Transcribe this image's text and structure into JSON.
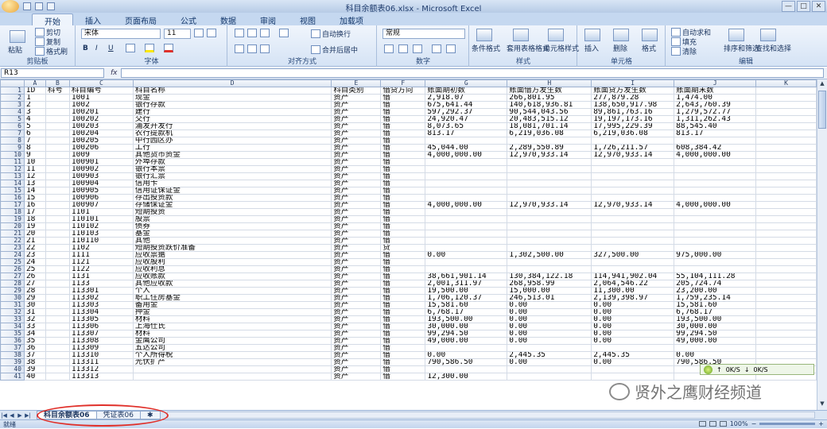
{
  "window": {
    "title": "科目余额表06.xlsx - Microsoft Excel",
    "controls": [
      "—",
      "□",
      "✕"
    ]
  },
  "ribbon": {
    "tabs": [
      "开始",
      "插入",
      "页面布局",
      "公式",
      "数据",
      "审阅",
      "视图",
      "加载项"
    ],
    "active_tab": "开始",
    "clipboard": {
      "label": "剪贴板",
      "paste": "粘贴",
      "cut": "剪切",
      "copy": "复制",
      "format_painter": "格式刷"
    },
    "font": {
      "label": "字体",
      "name": "宋体",
      "size": "11",
      "bold": "B",
      "italic": "I",
      "underline": "U"
    },
    "alignment": {
      "label": "对齐方式",
      "wrap": "自动换行",
      "merge": "合并后居中"
    },
    "number": {
      "label": "数字",
      "format": "常规"
    },
    "styles": {
      "label": "样式",
      "conditional": "条件格式",
      "table": "套用表格格式",
      "cell": "单元格样式"
    },
    "cells": {
      "label": "单元格",
      "insert": "插入",
      "delete": "删除",
      "format": "格式"
    },
    "editing": {
      "label": "编辑",
      "autosum": "自动求和",
      "fill": "填充",
      "clear": "清除",
      "sort": "排序和筛选",
      "find": "查找和选择"
    }
  },
  "formula_bar": {
    "name_box": "R13",
    "fx": "fx",
    "value": ""
  },
  "sheet": {
    "columns": [
      "A",
      "B",
      "C",
      "D",
      "E",
      "F",
      "G",
      "H",
      "I",
      "J",
      "K"
    ],
    "rows": [
      {
        "n": "1",
        "c": [
          "ID",
          "科号",
          "科目编号",
          "科目名称",
          "科目类别",
          "借贷方向",
          "账面期初数",
          "账面借方发生数",
          "账面贷方发生数",
          "账面期末数",
          ""
        ]
      },
      {
        "n": "2",
        "c": [
          "1",
          "",
          "1001",
          "现金",
          "资产",
          "借",
          "2,918.07",
          "266,801.95",
          "277,879.28",
          "1,474.00",
          ""
        ]
      },
      {
        "n": "3",
        "c": [
          "2",
          "",
          "1002",
          "银行存款",
          "资产",
          "借",
          "675,641.44",
          "140,618,936.81",
          "138,650,917.98",
          "2,643,760.39",
          ""
        ]
      },
      {
        "n": "4",
        "c": [
          "3",
          "",
          "100201",
          "建行",
          "资产",
          "借",
          "597,292.37",
          "90,544,043.56",
          "89,861,763.16",
          "1,279,572.77",
          ""
        ]
      },
      {
        "n": "5",
        "c": [
          "4",
          "",
          "100202",
          "交行",
          "资产",
          "借",
          "24,920.47",
          "20,483,515.12",
          "19,197,173.16",
          "1,311,262.43",
          ""
        ]
      },
      {
        "n": "6",
        "c": [
          "5",
          "",
          "100203",
          "浦发开发行",
          "资产",
          "借",
          "8,073.65",
          "18,081,701.14",
          "17,995,229.39",
          "88,545.40",
          ""
        ]
      },
      {
        "n": "7",
        "c": [
          "6",
          "",
          "100204",
          "农行提款机",
          "资产",
          "借",
          "813.17",
          "6,219,036.08",
          "6,219,036.08",
          "813.17",
          ""
        ]
      },
      {
        "n": "8",
        "c": [
          "7",
          "",
          "100205",
          "中行园区办",
          "资产",
          "借",
          "",
          "",
          "",
          "",
          ""
        ]
      },
      {
        "n": "9",
        "c": [
          "8",
          "",
          "100206",
          "工行",
          "资产",
          "借",
          "45,044.00",
          "2,289,550.89",
          "1,726,211.57",
          "608,384.42",
          ""
        ]
      },
      {
        "n": "10",
        "c": [
          "9",
          "",
          "1009",
          "其他货币资金",
          "资产",
          "借",
          "4,000,000.00",
          "12,970,933.14",
          "12,970,933.14",
          "4,000,000.00",
          ""
        ]
      },
      {
        "n": "11",
        "c": [
          "10",
          "",
          "100901",
          "外埠存款",
          "资产",
          "借",
          "",
          "",
          "",
          "",
          ""
        ]
      },
      {
        "n": "12",
        "c": [
          "11",
          "",
          "100902",
          "银行本票",
          "资产",
          "借",
          "",
          "",
          "",
          "",
          ""
        ]
      },
      {
        "n": "13",
        "c": [
          "12",
          "",
          "100903",
          "银行汇票",
          "资产",
          "借",
          "",
          "",
          "",
          "",
          ""
        ]
      },
      {
        "n": "14",
        "c": [
          "13",
          "",
          "100904",
          "信用卡",
          "资产",
          "借",
          "",
          "",
          "",
          "",
          ""
        ]
      },
      {
        "n": "15",
        "c": [
          "14",
          "",
          "100905",
          "信用证保证金",
          "资产",
          "借",
          "",
          "",
          "",
          "",
          ""
        ]
      },
      {
        "n": "16",
        "c": [
          "15",
          "",
          "100906",
          "存出投资款",
          "资产",
          "借",
          "",
          "",
          "",
          "",
          ""
        ]
      },
      {
        "n": "17",
        "c": [
          "16",
          "",
          "100907",
          "存储保证金",
          "资产",
          "借",
          "4,000,000.00",
          "12,970,933.14",
          "12,970,933.14",
          "4,000,000.00",
          ""
        ]
      },
      {
        "n": "18",
        "c": [
          "17",
          "",
          "1101",
          "短期投资",
          "资产",
          "借",
          "",
          "",
          "",
          "",
          ""
        ]
      },
      {
        "n": "19",
        "c": [
          "18",
          "",
          "110101",
          "股票",
          "资产",
          "借",
          "",
          "",
          "",
          "",
          ""
        ]
      },
      {
        "n": "20",
        "c": [
          "19",
          "",
          "110102",
          "债券",
          "资产",
          "借",
          "",
          "",
          "",
          "",
          ""
        ]
      },
      {
        "n": "21",
        "c": [
          "20",
          "",
          "110103",
          "基金",
          "资产",
          "借",
          "",
          "",
          "",
          "",
          ""
        ]
      },
      {
        "n": "22",
        "c": [
          "21",
          "",
          "110110",
          "其他",
          "资产",
          "借",
          "",
          "",
          "",
          "",
          ""
        ]
      },
      {
        "n": "23",
        "c": [
          "22",
          "",
          "1102",
          "短期投资跌价准备",
          "资产",
          "贷",
          "",
          "",
          "",
          "",
          ""
        ]
      },
      {
        "n": "24",
        "c": [
          "23",
          "",
          "1111",
          "应收票据",
          "资产",
          "借",
          "0.00",
          "1,302,500.00",
          "327,500.00",
          "975,000.00",
          ""
        ]
      },
      {
        "n": "25",
        "c": [
          "24",
          "",
          "1121",
          "应收股利",
          "资产",
          "借",
          "",
          "",
          "",
          "",
          ""
        ]
      },
      {
        "n": "26",
        "c": [
          "25",
          "",
          "1122",
          "应收利息",
          "资产",
          "借",
          "",
          "",
          "",
          "",
          ""
        ]
      },
      {
        "n": "27",
        "c": [
          "26",
          "",
          "1131",
          "应收账款",
          "资产",
          "借",
          "38,661,901.14",
          "130,384,122.18",
          "114,941,902.04",
          "55,104,111.28",
          ""
        ]
      },
      {
        "n": "28",
        "c": [
          "27",
          "",
          "1133",
          "其他应收款",
          "资产",
          "借",
          "2,001,311.97",
          "268,958.99",
          "2,064,546.22",
          "205,724.74",
          ""
        ]
      },
      {
        "n": "29",
        "c": [
          "28",
          "",
          "113301",
          "个人",
          "资产",
          "借",
          "19,500.00",
          "15,000.00",
          "11,300.00",
          "23,200.00",
          ""
        ]
      },
      {
        "n": "30",
        "c": [
          "29",
          "",
          "113302",
          "职工住房基金",
          "资产",
          "借",
          "1,706,120.37",
          "246,513.01",
          "2,139,398.97",
          "1,759,235.14",
          ""
        ]
      },
      {
        "n": "31",
        "c": [
          "30",
          "",
          "113303",
          "备用金",
          "资产",
          "借",
          "15,581.60",
          "0.00",
          "0.00",
          "15,581.60",
          ""
        ]
      },
      {
        "n": "32",
        "c": [
          "31",
          "",
          "113304",
          "押金",
          "资产",
          "借",
          "6,768.17",
          "0.00",
          "0.00",
          "6,768.17",
          ""
        ]
      },
      {
        "n": "33",
        "c": [
          "32",
          "",
          "113305",
          "材料",
          "资产",
          "借",
          "193,500.00",
          "0.00",
          "0.00",
          "193,500.00",
          ""
        ]
      },
      {
        "n": "34",
        "c": [
          "33",
          "",
          "113306",
          "上海仕氏",
          "资产",
          "借",
          "30,000.00",
          "0.00",
          "0.00",
          "30,000.00",
          ""
        ]
      },
      {
        "n": "35",
        "c": [
          "34",
          "",
          "113307",
          "材料",
          "资产",
          "借",
          "99,294.50",
          "0.00",
          "0.00",
          "99,294.50",
          ""
        ]
      },
      {
        "n": "36",
        "c": [
          "35",
          "",
          "113308",
          "金鹰公司",
          "资产",
          "借",
          "49,000.00",
          "0.00",
          "0.00",
          "49,000.00",
          ""
        ]
      },
      {
        "n": "37",
        "c": [
          "36",
          "",
          "113309",
          "五达公司",
          "资产",
          "借",
          "",
          "",
          "",
          "",
          ""
        ]
      },
      {
        "n": "38",
        "c": [
          "37",
          "",
          "113310",
          "个人所得税",
          "资产",
          "借",
          "0.00",
          "2,445.35",
          "2,445.35",
          "0.00",
          ""
        ]
      },
      {
        "n": "39",
        "c": [
          "38",
          "",
          "113311",
          "光伏扩产",
          "资产",
          "借",
          "790,586.50",
          "0.00",
          "0.00",
          "790,586.50",
          ""
        ]
      },
      {
        "n": "40",
        "c": [
          "39",
          "",
          "113312",
          "",
          "资产",
          "借",
          "",
          "",
          "",
          "",
          ""
        ]
      },
      {
        "n": "41",
        "c": [
          "40",
          "",
          "113313",
          "",
          "资产",
          "借",
          "12,300.00",
          "",
          "",
          "",
          ""
        ]
      }
    ]
  },
  "sheet_tabs": [
    {
      "label": "科目余额表06"
    },
    {
      "label": "凭证表06"
    }
  ],
  "status": {
    "ready": "就绪",
    "zoom": "100%"
  },
  "network_widget": {
    "up": "0K/S",
    "down": "0K/S"
  },
  "watermark": {
    "text": "贤外之鹰财经频道"
  },
  "colors": {
    "annotation": "#e0302a"
  }
}
